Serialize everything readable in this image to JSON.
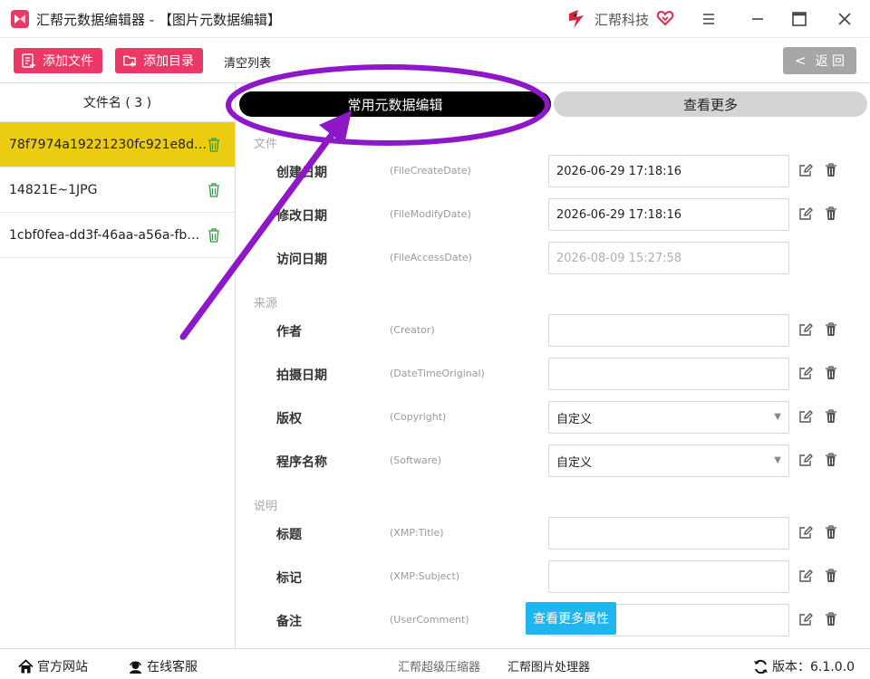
{
  "window": {
    "title": "汇帮元数据编辑器 - 【图片元数据编辑】",
    "brand": "汇帮科技"
  },
  "toolbar": {
    "add_file": "添加文件",
    "add_dir": "添加目录",
    "clear_list": "清空列表",
    "back": "返 回"
  },
  "file_list": {
    "header": "文件名 ( 3 )",
    "items": [
      {
        "name": "78f7974a19221230fc921e8d6e58...",
        "active": true
      },
      {
        "name": "14821E~1JPG",
        "active": false
      },
      {
        "name": "1cbf0fea-dd3f-46aa-a56a-fbb5...",
        "active": false
      }
    ]
  },
  "tabs": {
    "common": "常用元数据编辑",
    "more": "查看更多"
  },
  "sections": {
    "file": "文件",
    "source": "来源",
    "desc": "说明"
  },
  "fields": {
    "create_date": {
      "label": "创建日期",
      "key": "(FileCreateDate)",
      "value": "2026-06-29 17:18:16"
    },
    "modify_date": {
      "label": "修改日期",
      "key": "(FileModifyDate)",
      "value": "2026-06-29 17:18:16"
    },
    "access_date": {
      "label": "访问日期",
      "key": "(FileAccessDate)",
      "value": "2026-08-09 15:27:58"
    },
    "creator": {
      "label": "作者",
      "key": "(Creator)",
      "value": ""
    },
    "datetime_original": {
      "label": "拍摄日期",
      "key": "(DateTimeOriginal)",
      "value": ""
    },
    "copyright": {
      "label": "版权",
      "key": "(Copyright)",
      "value": "自定义"
    },
    "software": {
      "label": "程序名称",
      "key": "(Software)",
      "value": "自定义"
    },
    "title": {
      "label": "标题",
      "key": "(XMP:Title)",
      "value": ""
    },
    "subject": {
      "label": "标记",
      "key": "(XMP:Subject)",
      "value": ""
    },
    "comment": {
      "label": "备注",
      "key": "(UserComment)",
      "value": ""
    }
  },
  "more_attrs": "查看更多属性",
  "statusbar": {
    "website": "官方网站",
    "service": "在线客服",
    "compressor": "汇帮超级压缩器",
    "image_tool": "汇帮图片处理器",
    "version": "版本：6.1.0.0"
  },
  "colors": {
    "accent_pink": "#ec3864",
    "active_yellow": "#eccc10",
    "tab_black": "#000000",
    "info_blue": "#1fb5ee",
    "annotation_purple": "#8e18c8"
  }
}
